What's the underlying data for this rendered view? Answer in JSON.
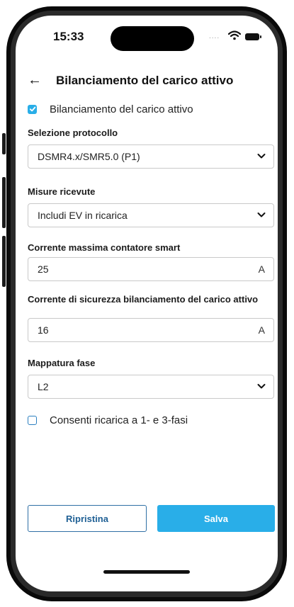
{
  "status": {
    "time": "15:33",
    "signal_dots": "....",
    "wifi_icon": "wifi-icon",
    "battery_icon": "battery-icon"
  },
  "header": {
    "back_icon": "arrow-left-icon",
    "back_glyph": "←",
    "title": "Bilanciamento del carico attivo"
  },
  "enable_checkbox": {
    "label": "Bilanciamento del carico attivo",
    "checked": true
  },
  "protocol": {
    "label": "Selezione protocollo",
    "value": "DSMR4.x/SMR5.0 (P1)"
  },
  "measures": {
    "label": "Misure ricevute",
    "value": "Includi EV in ricarica"
  },
  "max_current": {
    "label": "Corrente massima contatore smart",
    "value": "25",
    "unit": "A"
  },
  "safety_current": {
    "label": "Corrente di sicurezza bilanciamento del carico attivo",
    "value": "16",
    "unit": "A"
  },
  "phase_mapping": {
    "label": "Mappatura fase",
    "value": "L2"
  },
  "phase_checkbox": {
    "label": "Consenti ricarica a 1- e 3-fasi",
    "checked": false
  },
  "actions": {
    "reset_label": "Ripristina",
    "save_label": "Salva"
  },
  "colors": {
    "accent": "#29aee8",
    "secondary_border": "#2f6fa5"
  }
}
